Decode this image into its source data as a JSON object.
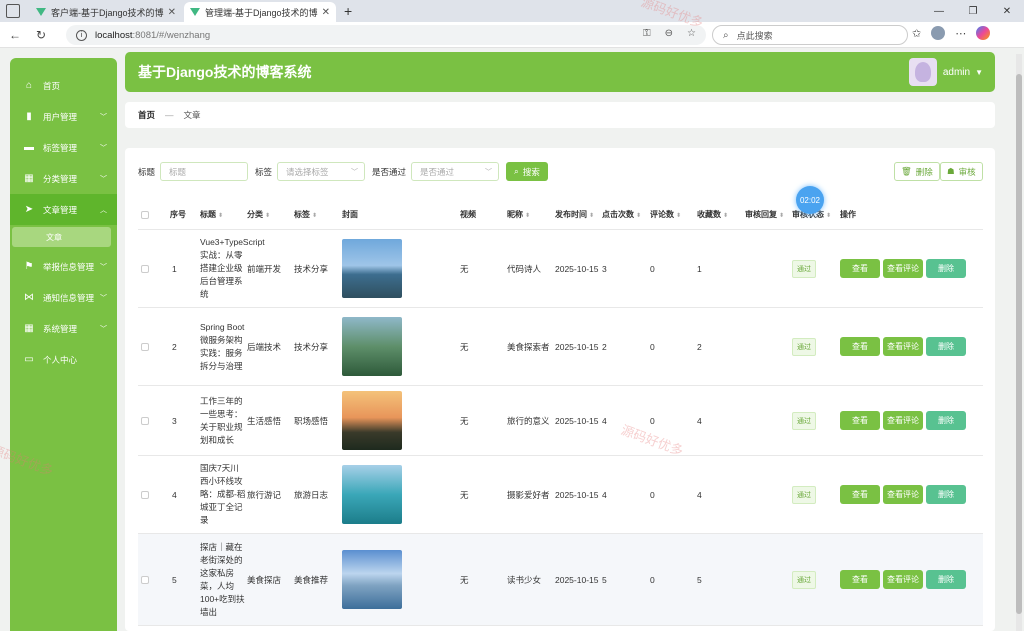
{
  "browser": {
    "tabs": [
      {
        "title": "客户端-基于Django技术的博客系"
      },
      {
        "title": "管理端-基于Django技术的博客系"
      }
    ],
    "url_host": "localhost",
    "url_path": ":8081/#/wenzhang",
    "search_placeholder": "点此搜索"
  },
  "app": {
    "title": "基于Django技术的博客系统",
    "user": "admin",
    "brand_color": "#7ac143"
  },
  "sidebar": {
    "items": [
      {
        "label": "首页",
        "icon": "home-icon"
      },
      {
        "label": "用户管理",
        "icon": "chart-icon"
      },
      {
        "label": "标签管理",
        "icon": "monitor-icon"
      },
      {
        "label": "分类管理",
        "icon": "grid-icon"
      },
      {
        "label": "文章管理",
        "icon": "send-icon"
      },
      {
        "label": "举报信息管理",
        "icon": "flag-icon"
      },
      {
        "label": "通知信息管理",
        "icon": "bowtie-icon"
      },
      {
        "label": "系统管理",
        "icon": "grid-icon"
      },
      {
        "label": "个人中心",
        "icon": "card-icon"
      }
    ],
    "sub_active": "文章"
  },
  "breadcrumb": {
    "home": "首页",
    "sep": "—",
    "current": "文章"
  },
  "filters": {
    "title_label": "标题",
    "title_placeholder": "标题",
    "tag_label": "标签",
    "tag_placeholder": "请选择标签",
    "pass_label": "是否通过",
    "pass_placeholder": "是否通过",
    "search_btn": "搜索",
    "delete_btn": "删除",
    "audit_btn": "审核"
  },
  "table": {
    "headers": {
      "no": "序号",
      "title": "标题",
      "category": "分类",
      "tag": "标签",
      "cover": "封面",
      "video": "视频",
      "nick": "昵称",
      "time": "发布时间",
      "clicks": "点击次数",
      "comments": "评论数",
      "favs": "收藏数",
      "reply": "审核回复",
      "status": "审核状态",
      "ops": "操作"
    },
    "rows": [
      {
        "no": "1",
        "title": "Vue3+TypeScript实战：从零搭建企业级后台管理系统",
        "category": "前端开发",
        "tag": "技术分享",
        "video": "无",
        "nick": "代码诗人",
        "time": "2025-10-15",
        "clicks": "3",
        "comments": "0",
        "favs": "1",
        "status": "通过"
      },
      {
        "no": "2",
        "title": "Spring Boot微服务架构实践：服务拆分与治理",
        "category": "后端技术",
        "tag": "技术分享",
        "video": "无",
        "nick": "美食探索者",
        "time": "2025-10-15",
        "clicks": "2",
        "comments": "0",
        "favs": "2",
        "status": "通过"
      },
      {
        "no": "3",
        "title": "工作三年的一些思考：关于职业规划和成长",
        "category": "生活感悟",
        "tag": "职场感悟",
        "video": "无",
        "nick": "旅行的意义",
        "time": "2025-10-15",
        "clicks": "4",
        "comments": "0",
        "favs": "4",
        "status": "通过"
      },
      {
        "no": "4",
        "title": "国庆7天川西小环线攻略：成都-稻城亚丁全记录",
        "category": "旅行游记",
        "tag": "旅游日志",
        "video": "无",
        "nick": "摄影爱好者",
        "time": "2025-10-15",
        "clicks": "4",
        "comments": "0",
        "favs": "4",
        "status": "通过"
      },
      {
        "no": "5",
        "title": "探店｜藏在老街深处的这家私房菜，人均100+吃到扶墙出",
        "category": "美食探店",
        "tag": "美食推荐",
        "video": "无",
        "nick": "读书少女",
        "time": "2025-10-15",
        "clicks": "5",
        "comments": "0",
        "favs": "5",
        "status": "通过"
      }
    ],
    "actions": {
      "view": "查看",
      "comments": "查看评论",
      "delete": "删除"
    }
  },
  "timer": "02:02",
  "watermark": "源码好优多"
}
